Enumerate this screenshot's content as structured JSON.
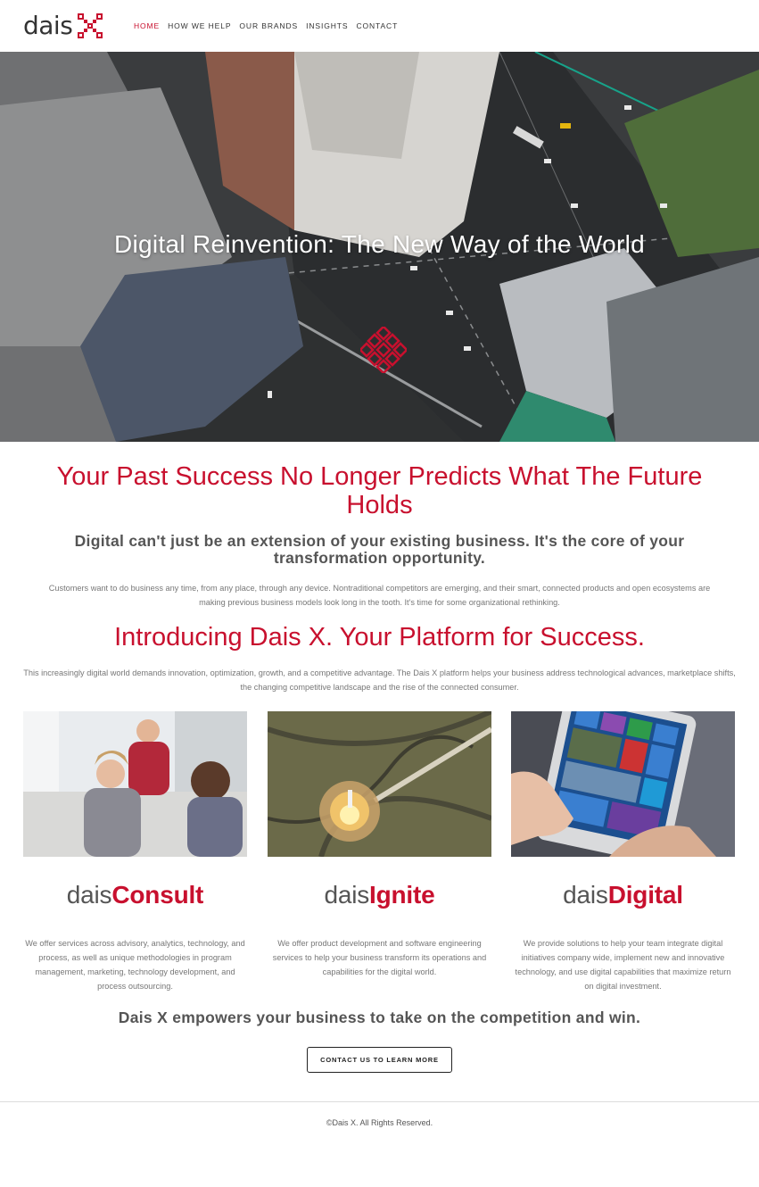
{
  "header": {
    "logo_text": "dais",
    "logo_icon": "dais-x-mark-icon",
    "nav": [
      {
        "label": "HOME",
        "active": true
      },
      {
        "label": "HOW WE HELP",
        "active": false
      },
      {
        "label": "OUR BRANDS",
        "active": false
      },
      {
        "label": "INSIGHTS",
        "active": false
      },
      {
        "label": "CONTACT",
        "active": false
      }
    ]
  },
  "hero": {
    "title": "Digital Reinvention: The New Way of the World",
    "icon": "dais-x-mark-icon"
  },
  "main": {
    "heading": "Your Past Success No Longer Predicts What The Future Holds",
    "subheading": "Digital can't just be an extension of your existing business. It's the core of your transformation opportunity.",
    "paragraph": "Customers want to do business any time, from any place, through any device. Nontraditional competitors are emerging, and their smart, connected products and open ecosystems are making previous business models look long in the tooth. It's time for some organizational rethinking.",
    "intro_heading": "Introducing Dais X. Your Platform for Success.",
    "intro_paragraph": "This increasingly digital world demands innovation, optimization, growth, and a competitive advantage. The Dais X platform helps your business address technological advances, marketplace shifts, the changing competitive landscape and the rise of the connected consumer."
  },
  "brands": [
    {
      "light": "dais",
      "bold": "Consult",
      "description": "We offer services across advisory, analytics, technology, and process, as well as unique methodologies in program management, marketing, technology development, and process outsourcing."
    },
    {
      "light": "dais",
      "bold": "Ignite",
      "description": "We offer product development and software engineering services to help your business transform its operations and capabilities for the digital world."
    },
    {
      "light": "dais",
      "bold": "Digital",
      "description": "We provide solutions to help your team integrate digital initiatives company wide, implement new and innovative technology, and use digital capabilities that maximize return on digital investment."
    }
  ],
  "tagline": "Dais X empowers your business to take on the competition and win.",
  "cta_label": "CONTACT US TO LEARN MORE",
  "footer": {
    "copyright": "©Dais X. All Rights Reserved."
  },
  "colors": {
    "brand_red": "#c8102e",
    "text_dark": "#333333",
    "text_gray": "#555555"
  }
}
